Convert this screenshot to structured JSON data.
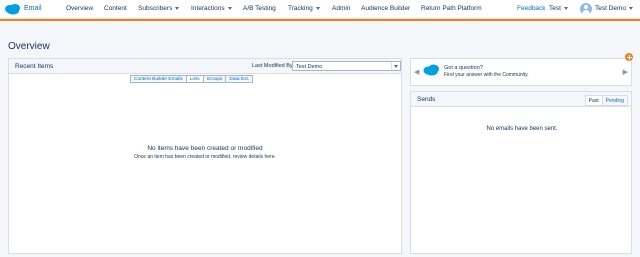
{
  "app": {
    "name": "Email",
    "logo_icon": "salesforce-cloud-icon",
    "brand_color": "#00a1e0",
    "accent_color": "#e8871e"
  },
  "nav": {
    "items": [
      {
        "label": "Overview",
        "has_menu": false
      },
      {
        "label": "Content",
        "has_menu": false
      },
      {
        "label": "Subscribers",
        "has_menu": true
      },
      {
        "label": "Interactions",
        "has_menu": true
      },
      {
        "label": "A/B Testing",
        "has_menu": false
      },
      {
        "label": "Tracking",
        "has_menu": true
      },
      {
        "label": "Admin",
        "has_menu": false
      },
      {
        "label": "Audience Builder",
        "has_menu": false
      },
      {
        "label": "Return Path Platform",
        "has_menu": false
      }
    ],
    "feedback": "Feedback",
    "business_unit": "Test",
    "user": "Test Demo"
  },
  "page": {
    "title": "Overview"
  },
  "recent_items": {
    "title": "Recent Items",
    "sort_label": "Last Modified By",
    "sort_value": "Test Demo",
    "tabs": [
      "Content Builder Emails",
      "Lists",
      "Groups",
      "Data Ext."
    ],
    "active_tab": "Lists",
    "empty_title": "No items have been created or modified",
    "empty_sub": "Once an item has been created or modified, review details here."
  },
  "help": {
    "question": "Got a question?",
    "answer": "Find your answer with the Community."
  },
  "sends": {
    "title": "Sends",
    "tabs": [
      "Past",
      "Pending"
    ],
    "active_tab": "Past",
    "empty": "No emails have been sent."
  }
}
